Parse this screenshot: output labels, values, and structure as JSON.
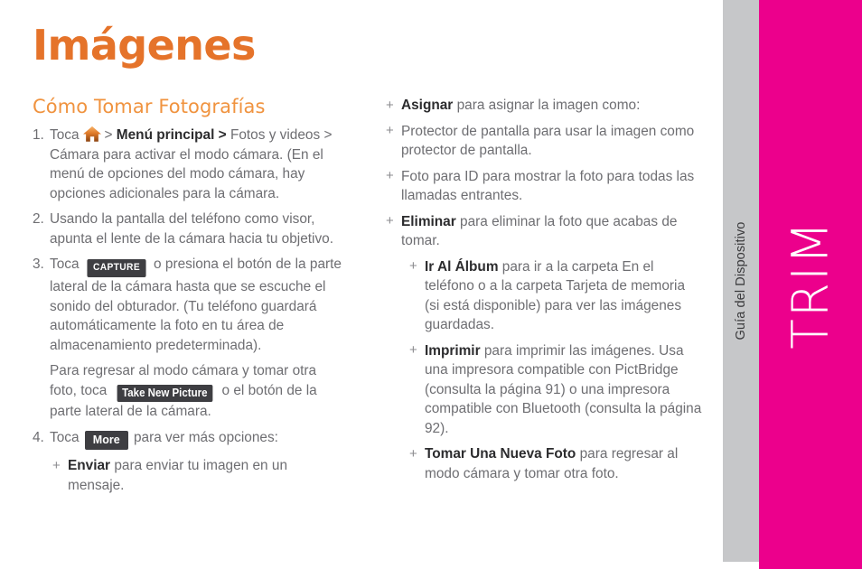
{
  "page": {
    "title": "Imágenes",
    "subtitle": "Cómo Tomar Fotografías"
  },
  "colors": {
    "title_orange": "#e5732a",
    "subtitle_orange": "#f0933f",
    "magenta": "#ec008c",
    "gray_strip": "#c6c7c9",
    "chip_dark": "#3e3e42",
    "body_text": "#6e6e72",
    "bold_text": "#2c2c2e"
  },
  "edge": {
    "guide_label": "Guía del Dispositivo",
    "brand_label": "TRIM"
  },
  "chips": {
    "capture": "CAPTURE",
    "take_new_picture": "Take New Picture",
    "more": "More"
  },
  "icons": {
    "home": "home-icon"
  },
  "left_column": {
    "step1": {
      "number": "1.",
      "text_a": "Toca",
      "bold_b": "Menú principal >",
      "text_c": "Fotos y videos > Cámara para activar el modo cámara. (En el menú de opciones del modo cámara, hay opciones adicionales para la cámara."
    },
    "step2": {
      "number": "2.",
      "text": "Usando la pantalla del teléfono como visor, apunta el lente de la cámara hacia tu objetivo."
    },
    "step3": {
      "number": "3.",
      "text_a": "Toca",
      "text_b": "o presiona el botón de la parte lateral de la cámara hasta que se escuche el sonido del obturador. (Tu teléfono guardará automáticamente la foto en tu área de almacenamiento predeterminada)."
    },
    "para_retake": {
      "text_a": "Para regresar al modo cámara y tomar otra foto, toca",
      "text_b": "o el botón de la parte lateral de la cámara."
    },
    "step4": {
      "number": "4.",
      "text_a": "Toca",
      "text_b": "para ver más opciones:"
    },
    "bullet_enviar": {
      "mark": "+",
      "bold": "Enviar",
      "text": "para enviar tu imagen en un mensaje."
    }
  },
  "right_column": {
    "bullets": [
      {
        "mark": "+",
        "bold": "Asignar",
        "text": "para asignar la imagen como:",
        "indent": 0
      },
      {
        "mark": "+",
        "bold": "",
        "text": "Protector de pantalla para usar la imagen como protector de pantalla.",
        "indent": 0
      },
      {
        "mark": "+",
        "bold": "",
        "text": "Foto para ID para mostrar la foto para todas las llamadas entrantes.",
        "indent": 0
      },
      {
        "mark": "+",
        "bold": "Eliminar",
        "text": "para eliminar la foto que acabas de tomar.",
        "indent": 0
      },
      {
        "mark": "+",
        "bold": "Ir Al Álbum",
        "text": "para ir a la carpeta En el teléfono o a la carpeta Tarjeta de memoria (si está disponible) para ver las imágenes guardadas.",
        "indent": 1
      },
      {
        "mark": "+",
        "bold": "Imprimir",
        "text": "para imprimir las imágenes. Usa una impresora compatible con PictBridge (consulta la página 91) o una impresora compatible con Bluetooth (consulta la página 92).",
        "indent": 1
      },
      {
        "mark": "+",
        "bold": "Tomar Una Nueva Foto",
        "text": "para regresar al modo cámara y tomar otra foto.",
        "indent": 1
      }
    ]
  }
}
